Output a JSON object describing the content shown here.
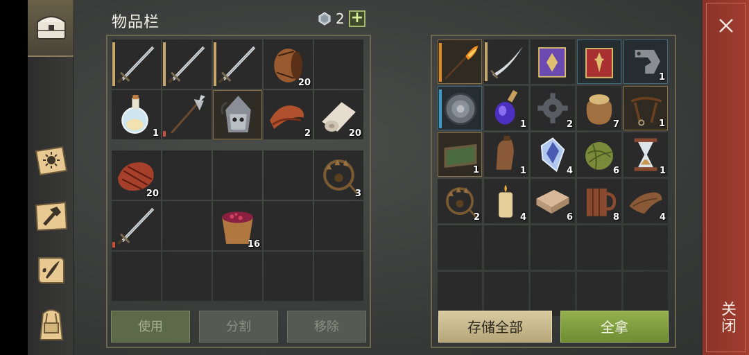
{
  "inventory": {
    "title": "物品栏",
    "currency_count": "2",
    "plus_label": "+",
    "rows": [
      [
        {
          "icon": "sword-icon",
          "qty": "",
          "dur": "tan"
        },
        {
          "icon": "sword-icon",
          "qty": "",
          "dur": "tan"
        },
        {
          "icon": "sword-icon",
          "qty": "",
          "dur": "tan"
        },
        {
          "icon": "barrel-icon",
          "qty": "20"
        },
        {
          "icon": "",
          "qty": ""
        }
      ],
      [
        {
          "icon": "potion-flask-icon",
          "qty": "1"
        },
        {
          "icon": "halberd-icon",
          "qty": "",
          "dur": "red"
        },
        {
          "icon": "helmet-mask-icon",
          "qty": "",
          "highlight": true
        },
        {
          "icon": "meat-strips-icon",
          "qty": "2"
        },
        {
          "icon": "cloth-roll-icon",
          "qty": "20"
        }
      ]
    ],
    "rows2": [
      [
        {
          "icon": "steak-icon",
          "qty": "20"
        },
        {
          "icon": "",
          "qty": ""
        },
        {
          "icon": "",
          "qty": ""
        },
        {
          "icon": "",
          "qty": ""
        },
        {
          "icon": "bear-trap-icon",
          "qty": "3"
        }
      ],
      [
        {
          "icon": "sword-icon",
          "qty": "",
          "dur": "red"
        },
        {
          "icon": "",
          "qty": ""
        },
        {
          "icon": "berry-bucket-icon",
          "qty": "16"
        },
        {
          "icon": "",
          "qty": ""
        },
        {
          "icon": "",
          "qty": ""
        }
      ],
      [
        {
          "icon": "",
          "qty": ""
        },
        {
          "icon": "",
          "qty": ""
        },
        {
          "icon": "",
          "qty": ""
        },
        {
          "icon": "",
          "qty": ""
        },
        {
          "icon": "",
          "qty": ""
        }
      ]
    ],
    "buttons": {
      "use": "使用",
      "split": "分割",
      "remove": "移除"
    }
  },
  "storage": {
    "rows": [
      [
        {
          "icon": "flame-spear-icon",
          "qty": "",
          "dur": "orange",
          "style": "gold"
        },
        {
          "icon": "sabre-icon",
          "qty": "",
          "dur": "tan"
        },
        {
          "icon": "purple-book-icon",
          "qty": ""
        },
        {
          "icon": "red-book-icon",
          "qty": "",
          "style": "blue"
        },
        {
          "icon": "metal-clamp-icon",
          "qty": "1",
          "style": "blue"
        }
      ],
      [
        {
          "icon": "round-shield-icon",
          "qty": "",
          "dur": "blue",
          "style": "blue"
        },
        {
          "icon": "purple-potion-icon",
          "qty": "1"
        },
        {
          "icon": "gear-icon",
          "qty": "2"
        },
        {
          "icon": "grain-sack-icon",
          "qty": "7"
        },
        {
          "icon": "leather-strap-icon",
          "qty": "1",
          "style": "gold"
        }
      ],
      [
        {
          "icon": "tray-icon",
          "qty": "1",
          "style": "gold"
        },
        {
          "icon": "leather-bottle-icon",
          "qty": "1"
        },
        {
          "icon": "crystal-icon",
          "qty": "4"
        },
        {
          "icon": "twine-ball-icon",
          "qty": "6"
        },
        {
          "icon": "hourglass-icon",
          "qty": "1"
        }
      ],
      [
        {
          "icon": "bear-trap-icon",
          "qty": "2"
        },
        {
          "icon": "candle-icon",
          "qty": "4"
        },
        {
          "icon": "folded-cloth-icon",
          "qty": "6"
        },
        {
          "icon": "wooden-mug-icon",
          "qty": "8"
        },
        {
          "icon": "leather-scrap-icon",
          "qty": "4"
        }
      ],
      [
        {
          "icon": "",
          "qty": ""
        },
        {
          "icon": "",
          "qty": ""
        },
        {
          "icon": "",
          "qty": ""
        },
        {
          "icon": "",
          "qty": ""
        },
        {
          "icon": "",
          "qty": ""
        }
      ],
      [
        {
          "icon": "",
          "qty": ""
        },
        {
          "icon": "",
          "qty": ""
        },
        {
          "icon": "",
          "qty": ""
        },
        {
          "icon": "",
          "qty": ""
        },
        {
          "icon": "",
          "qty": ""
        }
      ]
    ],
    "buttons": {
      "store_all": "存储全部",
      "take_all": "全拿"
    }
  },
  "sidebar": {
    "items": [
      {
        "icon": "chest-icon",
        "active": true
      },
      {
        "icon": "sun-book-icon"
      },
      {
        "icon": "hammer-map-icon"
      },
      {
        "icon": "quill-scroll-icon"
      },
      {
        "icon": "backpack-icon"
      }
    ]
  },
  "close": {
    "label": "关闭"
  },
  "colors": {
    "accent_green": "#94b04e",
    "close_red": "#9a3a2e",
    "frame": "#6b6650"
  }
}
